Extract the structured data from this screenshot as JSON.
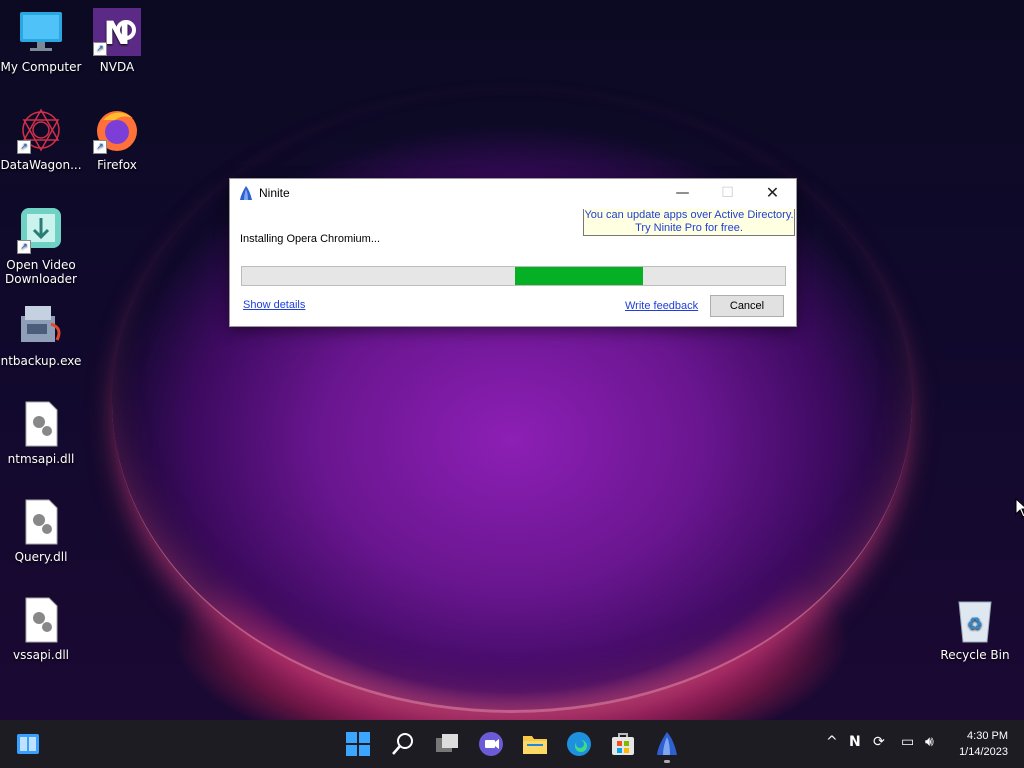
{
  "desktop": {
    "icons": [
      {
        "label": "My Computer",
        "icon": "monitor-icon"
      },
      {
        "label": "NVDA",
        "icon": "nvda-icon"
      },
      {
        "label": "DataWagon...",
        "icon": "datawagon-icon"
      },
      {
        "label": "Firefox",
        "icon": "firefox-icon"
      },
      {
        "label": "Open Video Downloader",
        "icon": "video-downloader-icon"
      },
      {
        "label": "ntbackup.exe",
        "icon": "backup-icon"
      },
      {
        "label": "ntmsapi.dll",
        "icon": "dll-file-icon"
      },
      {
        "label": "Query.dll",
        "icon": "dll-file-icon"
      },
      {
        "label": "vssapi.dll",
        "icon": "dll-file-icon"
      },
      {
        "label": "Recycle Bin",
        "icon": "recycle-bin-icon"
      }
    ]
  },
  "dialog": {
    "title": "Ninite",
    "tip_line1": "You can update apps over Active Directory.",
    "tip_line2": "Try Ninite Pro for free.",
    "status": "Installing Opera Chromium...",
    "progress_percent": 24,
    "show_details": "Show details",
    "write_feedback": "Write feedback",
    "cancel": "Cancel"
  },
  "taskbar": {
    "time": "4:30 PM",
    "date": "1/14/2023"
  },
  "colors": {
    "progress_green": "#06b025",
    "link_blue": "#1f3fd8",
    "tip_bg": "#ffffe1"
  }
}
